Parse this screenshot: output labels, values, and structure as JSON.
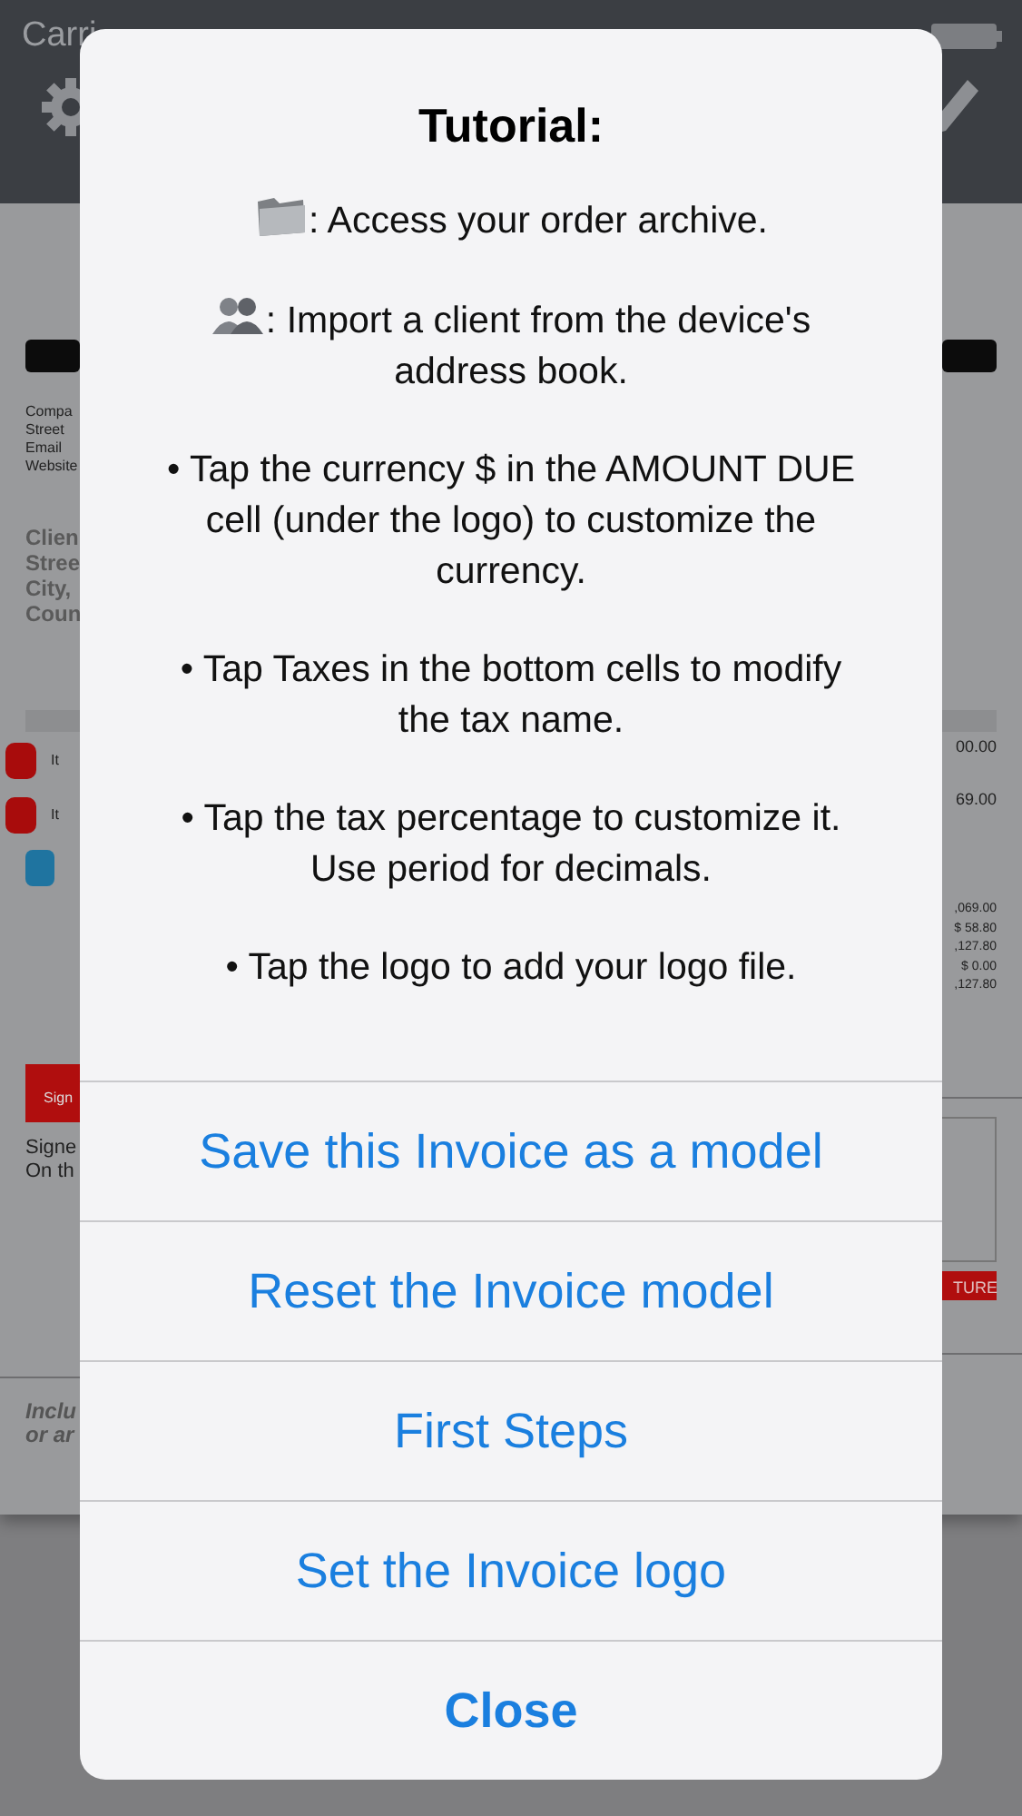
{
  "status_bar": {
    "carrier": "Carri"
  },
  "invoice_left": {
    "company_lines": [
      "Compa",
      "Street",
      "Email",
      "Website"
    ],
    "client_lines": [
      "Clien",
      "Stree",
      "City,",
      "Coun"
    ],
    "item_rows": [
      "It",
      "It"
    ],
    "sign_button": "Sign",
    "signed_lines": [
      "Signe",
      "On th"
    ],
    "footer_lines": [
      "Inclu",
      "or ar"
    ]
  },
  "invoice_right": {
    "item_amounts": [
      "00.00",
      "69.00"
    ],
    "totals": [
      ",069.00",
      "$ 58.80",
      ",127.80",
      "$ 0.00",
      ",127.80"
    ],
    "signature_button": "TURE"
  },
  "alert": {
    "title": "Tutorial:",
    "messages": [
      {
        "kind": "folder",
        "text": ":  Access your order archive."
      },
      {
        "kind": "people",
        "text": ": Import a client from the device's address book."
      },
      {
        "kind": "bullet",
        "text": "• Tap the currency $ in the AMOUNT DUE cell (under the logo) to customize the currency."
      },
      {
        "kind": "bullet",
        "text": "• Tap Taxes in the bottom cells to modify the tax name."
      },
      {
        "kind": "bullet",
        "text": "• Tap the tax percentage to customize it. Use period for decimals."
      },
      {
        "kind": "bullet",
        "text": "• Tap the logo to add your logo file."
      }
    ],
    "buttons": [
      {
        "label": "Save this Invoice as a model",
        "bold": false
      },
      {
        "label": "Reset the Invoice model",
        "bold": false
      },
      {
        "label": "First Steps",
        "bold": false
      },
      {
        "label": "Set the Invoice logo",
        "bold": false
      },
      {
        "label": "Close",
        "bold": true
      }
    ]
  }
}
